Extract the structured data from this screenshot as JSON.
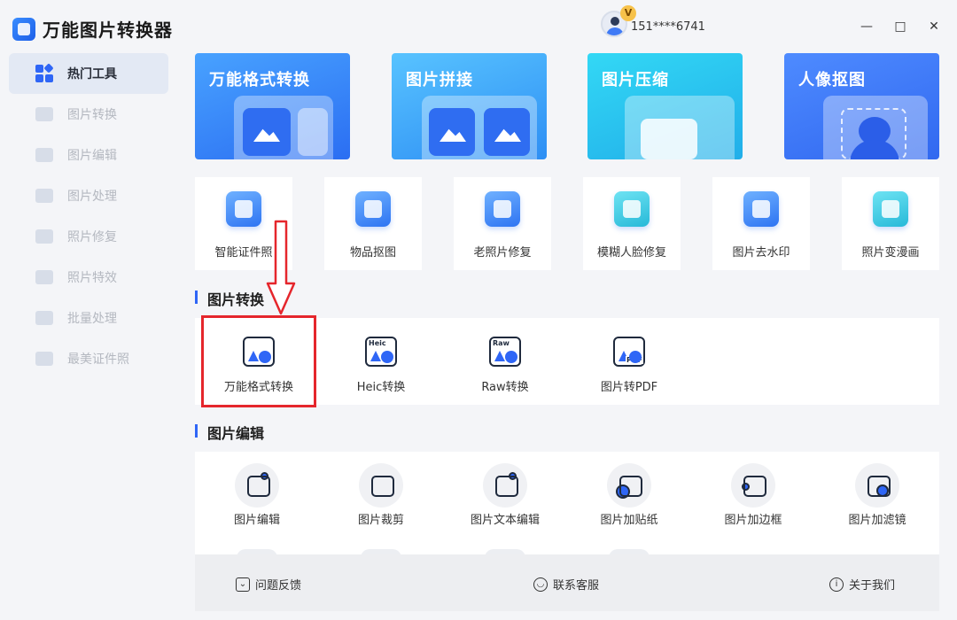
{
  "app": {
    "title": "万能图片转换器"
  },
  "user": {
    "phone": "151****6741",
    "vip_badge": "V"
  },
  "window_controls": {
    "minimize": "—",
    "maximize": "□",
    "close": "✕"
  },
  "sidebar": {
    "items": [
      {
        "label": "热门工具",
        "icon": "grid-icon",
        "active": true
      },
      {
        "label": "图片转换",
        "icon": "image-convert-icon"
      },
      {
        "label": "图片编辑",
        "icon": "image-edit-icon"
      },
      {
        "label": "图片处理",
        "icon": "image-process-icon"
      },
      {
        "label": "照片修复",
        "icon": "photo-repair-icon"
      },
      {
        "label": "照片特效",
        "icon": "photo-effect-icon"
      },
      {
        "label": "批量处理",
        "icon": "batch-icon"
      },
      {
        "label": "最美证件照",
        "icon": "id-photo-icon"
      }
    ]
  },
  "banners": [
    {
      "label": "万能格式转换",
      "icon": "format-convert-icon"
    },
    {
      "label": "图片拼接",
      "icon": "image-stitch-icon"
    },
    {
      "label": "图片压缩",
      "icon": "image-compress-icon"
    },
    {
      "label": "人像抠图",
      "icon": "portrait-cutout-icon"
    }
  ],
  "tools": [
    {
      "label": "智能证件照",
      "icon": "id-card-icon"
    },
    {
      "label": "物品抠图",
      "icon": "bag-icon"
    },
    {
      "label": "老照片修复",
      "icon": "wrench-icon"
    },
    {
      "label": "模糊人脸修复",
      "icon": "face-repair-icon"
    },
    {
      "label": "图片去水印",
      "icon": "eraser-icon"
    },
    {
      "label": "照片变漫画",
      "icon": "cartoon-icon"
    }
  ],
  "sections": {
    "convert": "图片转换",
    "edit": "图片编辑"
  },
  "convert_tools": [
    {
      "label": "万能格式转换",
      "tag": ""
    },
    {
      "label": "Heic转换",
      "tag": "Heic"
    },
    {
      "label": "Raw转换",
      "tag": "Raw"
    },
    {
      "label": "图片转PDF",
      "tag": "PDF"
    }
  ],
  "edit_tools": [
    {
      "label": "图片编辑",
      "icon": "image-settings-icon"
    },
    {
      "label": "图片裁剪",
      "icon": "crop-icon"
    },
    {
      "label": "图片文本编辑",
      "icon": "text-edit-icon"
    },
    {
      "label": "图片加贴纸",
      "icon": "sticker-icon"
    },
    {
      "label": "图片加边框",
      "icon": "frame-icon"
    },
    {
      "label": "图片加滤镜",
      "icon": "filter-icon"
    }
  ],
  "footer": {
    "feedback": "问题反馈",
    "support": "联系客服",
    "about": "关于我们"
  },
  "colors": {
    "accent": "#2f66f6",
    "highlight": "#e5262c"
  }
}
